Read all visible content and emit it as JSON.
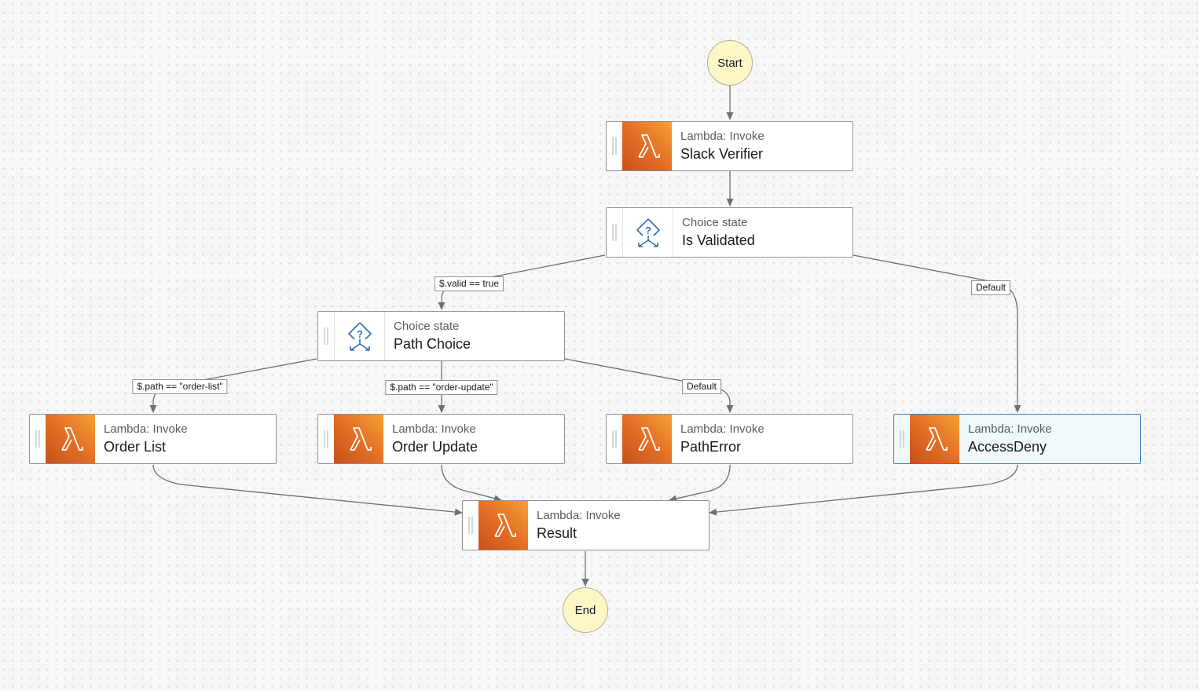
{
  "diagram": {
    "start_label": "Start",
    "end_label": "End",
    "states": {
      "slack_verifier": {
        "type": "Lambda: Invoke",
        "name": "Slack Verifier"
      },
      "is_validated": {
        "type": "Choice state",
        "name": "Is Validated"
      },
      "path_choice": {
        "type": "Choice state",
        "name": "Path Choice"
      },
      "order_list": {
        "type": "Lambda: Invoke",
        "name": "Order List"
      },
      "order_update": {
        "type": "Lambda: Invoke",
        "name": "Order Update"
      },
      "path_error": {
        "type": "Lambda: Invoke",
        "name": "PathError"
      },
      "access_deny": {
        "type": "Lambda: Invoke",
        "name": "AccessDeny"
      },
      "result": {
        "type": "Lambda: Invoke",
        "name": "Result"
      }
    },
    "transitions": {
      "valid_true": "$.valid == true",
      "validated_default": "Default",
      "path_order_list": "$.path == \"order-list\"",
      "path_order_update": "$.path == \"order-update\"",
      "path_default": "Default"
    },
    "selected_state": "AccessDeny",
    "icons": {
      "lambda": "lambda-icon",
      "choice": "choice-state-icon",
      "grip": "drag-handle-icon"
    },
    "colors": {
      "lambda_gradient_start": "#f7a135",
      "lambda_gradient_end": "#c8511b",
      "terminal_fill": "#fdf7c8",
      "selected_border": "#3c7fc4",
      "selected_fill": "#f1f8fb",
      "edge": "#6b7075",
      "choice_icon": "#2f6fb0"
    }
  }
}
